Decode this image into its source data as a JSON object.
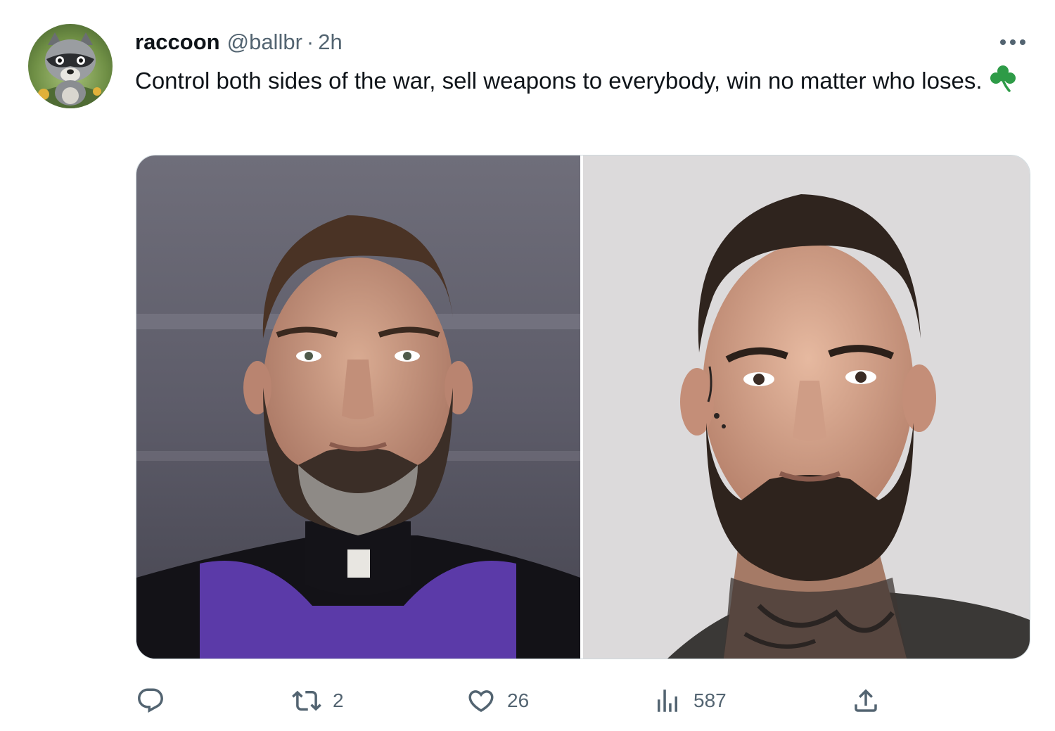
{
  "tweet": {
    "display_name": "raccoon",
    "handle": "@ballbr",
    "separator": "·",
    "time": "2h",
    "text": "Control both sides of the war, sell weapons to everybody, win no matter who loses.",
    "emoji": "shamrock",
    "media": [
      {
        "icon": "photo-man-purple-robe"
      },
      {
        "icon": "photo-man-neck-tattoos"
      }
    ]
  },
  "actions": {
    "reply": {
      "icon": "reply-icon",
      "count": ""
    },
    "repost": {
      "icon": "repost-icon",
      "count": "2"
    },
    "like": {
      "icon": "heart-icon",
      "count": "26"
    },
    "views": {
      "icon": "views-icon",
      "count": "587"
    },
    "share": {
      "icon": "share-icon",
      "count": ""
    }
  },
  "colors": {
    "text_primary": "#0f1419",
    "text_secondary": "#536471",
    "shamrock": "#2e9b47",
    "robe_purple": "#5b3aa8"
  }
}
